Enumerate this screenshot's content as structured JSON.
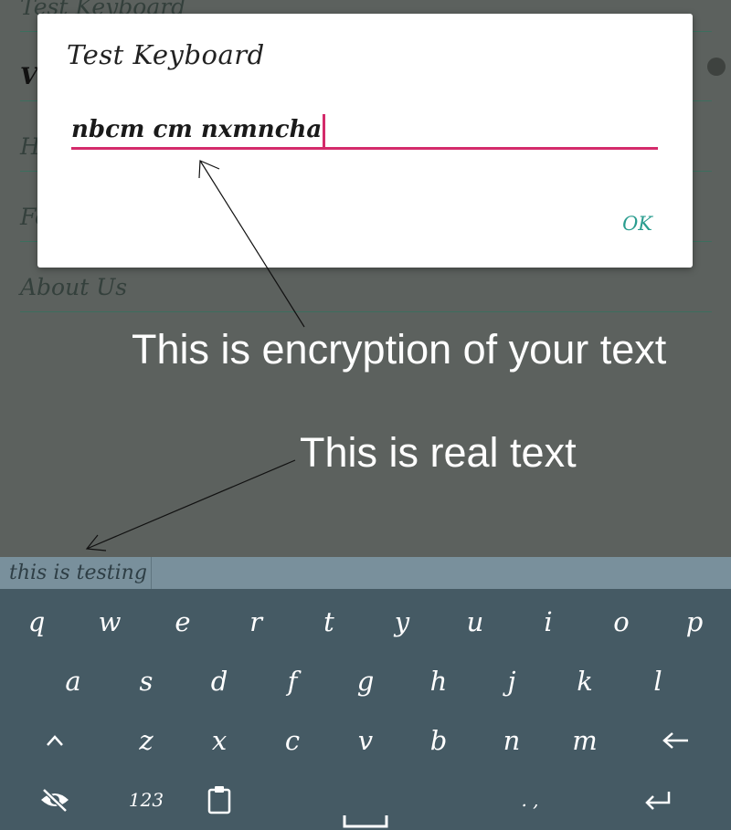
{
  "settings_list": {
    "items": [
      {
        "label": "Test Keyboard"
      },
      {
        "label": "Vi"
      },
      {
        "label": "H"
      },
      {
        "label": "Fe"
      },
      {
        "label": "About Us"
      }
    ]
  },
  "dialog": {
    "title": "Test Keyboard",
    "input_value": "nbcm cm nxmncha",
    "ok_label": "OK"
  },
  "annotations": {
    "encryption": "This is encryption of your text",
    "real": "This is real text"
  },
  "suggestion": {
    "text": "this is testing"
  },
  "keyboard": {
    "row1": [
      "q",
      "w",
      "e",
      "r",
      "t",
      "y",
      "u",
      "i",
      "o",
      "p"
    ],
    "row2": [
      "a",
      "s",
      "d",
      "f",
      "g",
      "h",
      "j",
      "k",
      "l"
    ],
    "row3": [
      "z",
      "x",
      "c",
      "v",
      "b",
      "n",
      "m"
    ],
    "numbers_label": "123",
    "punct_label": ". ,"
  },
  "colors": {
    "accent": "#d42b6b",
    "ok": "#2a9d8f",
    "keyboard_bg": "#455a64",
    "suggestion_bg": "#79909c"
  },
  "icons": {
    "shift": "shift-icon",
    "backspace": "backspace-icon",
    "hide": "eye-off-icon",
    "clipboard": "clipboard-icon",
    "space": "spacebar-icon",
    "enter": "enter-icon"
  }
}
